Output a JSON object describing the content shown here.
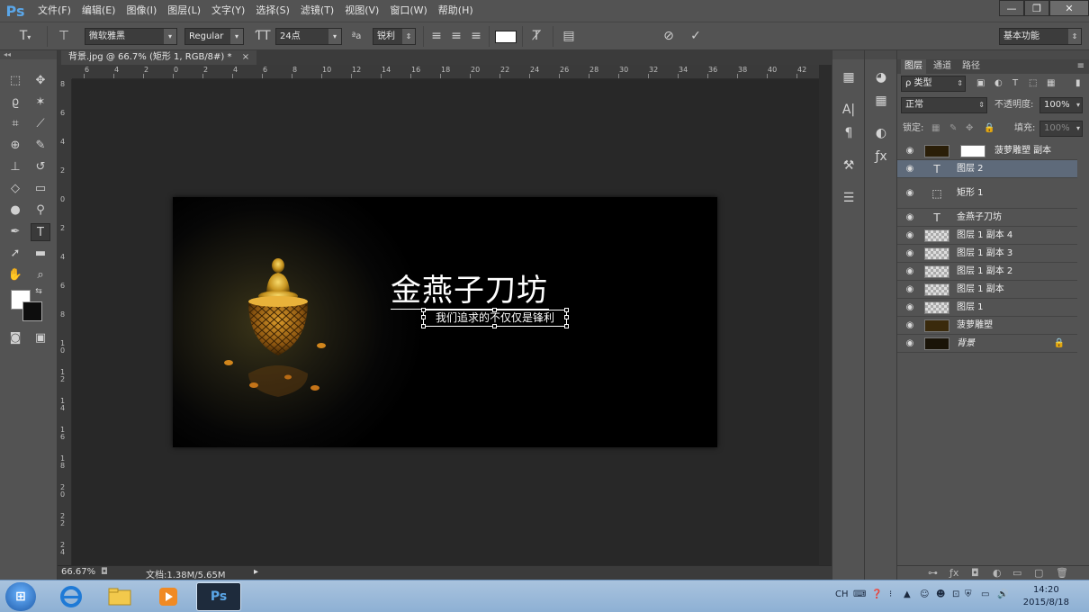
{
  "app": {
    "logo": "Ps"
  },
  "menu": [
    "文件(F)",
    "编辑(E)",
    "图像(I)",
    "图层(L)",
    "文字(Y)",
    "选择(S)",
    "滤镜(T)",
    "视图(V)",
    "窗口(W)",
    "帮助(H)"
  ],
  "window_controls": {
    "minimize": "—",
    "restore": "❐",
    "close": "✕"
  },
  "options": {
    "font_family": "微软雅黑",
    "font_style": "Regular",
    "font_size": "24点",
    "aa_icon": "ªa",
    "antialias": "锐利",
    "workspace": "基本功能"
  },
  "document": {
    "tab_title": "背景.jpg @ 66.7% (矩形 1, RGB/8#) *",
    "tab_close": "×"
  },
  "ruler_top": [
    "6",
    "4",
    "2",
    "0",
    "2",
    "4",
    "6",
    "8",
    "10",
    "12",
    "14",
    "16",
    "18",
    "20",
    "22",
    "24",
    "26",
    "28",
    "30",
    "32",
    "34",
    "36",
    "38",
    "40",
    "42"
  ],
  "ruler_left": [
    "8",
    "6",
    "4",
    "2",
    "0",
    "2",
    "4",
    "6",
    "8",
    "10",
    "12",
    "14",
    "16",
    "18",
    "20",
    "22",
    "24"
  ],
  "canvas": {
    "title": "金燕子刀坊",
    "slogan": "我们追求的不仅仅是锋利"
  },
  "status": {
    "zoom": "66.67%",
    "doc_info": "文档:1.38M/5.65M"
  },
  "panel_tabs": [
    "图层",
    "通道",
    "路径"
  ],
  "layers_panel": {
    "filter_type": "ρ 类型",
    "blend_mode": "正常",
    "opacity_label": "不透明度:",
    "opacity_value": "100%",
    "lock_label": "锁定:",
    "fill_label": "填充:",
    "fill_value": "100%"
  },
  "layers": [
    {
      "name": "菠萝雕塑 副本",
      "kind": "smart-mask"
    },
    {
      "name": "图层 2",
      "kind": "text",
      "selected": true
    },
    {
      "name": "矩形 1",
      "kind": "shape",
      "tall": true
    },
    {
      "name": "金燕子刀坊",
      "kind": "text"
    },
    {
      "name": "图层 1 副本 4",
      "kind": "pixel"
    },
    {
      "name": "图层 1 副本 3",
      "kind": "pixel"
    },
    {
      "name": "图层 1 副本 2",
      "kind": "pixel"
    },
    {
      "name": "图层 1 副本",
      "kind": "pixel"
    },
    {
      "name": "图层 1",
      "kind": "pixel"
    },
    {
      "name": "菠萝雕塑",
      "kind": "smart"
    },
    {
      "name": "背景",
      "kind": "background",
      "locked": true
    }
  ],
  "taskbar": {
    "tray_lang": "CH",
    "time": "14:20",
    "date": "2015/8/18",
    "ps_label": "Ps"
  }
}
